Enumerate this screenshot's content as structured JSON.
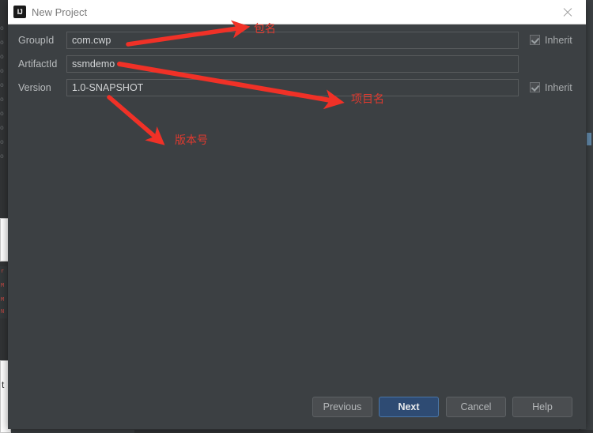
{
  "background": {
    "gutter_chars": [
      "o",
      "o",
      "o",
      "o",
      "o",
      "o",
      "o",
      "o",
      "o",
      "o"
    ],
    "red_fragments": [
      "r",
      "M",
      "M",
      "N"
    ],
    "white_panel_text": "t"
  },
  "titlebar": {
    "logo": "IJ",
    "logo_icon_name": "intellij-idea-logo-icon",
    "title": "New Project",
    "close_icon_name": "close-icon"
  },
  "form": {
    "rows": [
      {
        "label": "GroupId",
        "value": "com.cwp",
        "placeholder": "GroupId",
        "inherit": {
          "label": "Inherit",
          "checked": true
        }
      },
      {
        "label": "ArtifactId",
        "value": "ssmdemo",
        "placeholder": "ArtifactId",
        "inherit": null
      },
      {
        "label": "Version",
        "value": "1.0-SNAPSHOT",
        "placeholder": "Version",
        "inherit": {
          "label": "Inherit",
          "checked": true
        }
      }
    ]
  },
  "annotations": {
    "color": "#e03a2f",
    "items": [
      {
        "text": "包名",
        "meaning": "package-name"
      },
      {
        "text": "项目名",
        "meaning": "project-name"
      },
      {
        "text": "版本号",
        "meaning": "version-number"
      }
    ]
  },
  "footer": {
    "previous": "Previous",
    "next": "Next",
    "cancel": "Cancel",
    "help": "Help"
  },
  "colors": {
    "dialog_background": "#3c4043",
    "titlebar_background": "#ffffff",
    "accent_button": "#2e4b73",
    "accent_border": "#4a76a8",
    "annotation_red": "#e03a2f",
    "field_border": "#585b5d",
    "label_text": "#b9bcbe"
  }
}
